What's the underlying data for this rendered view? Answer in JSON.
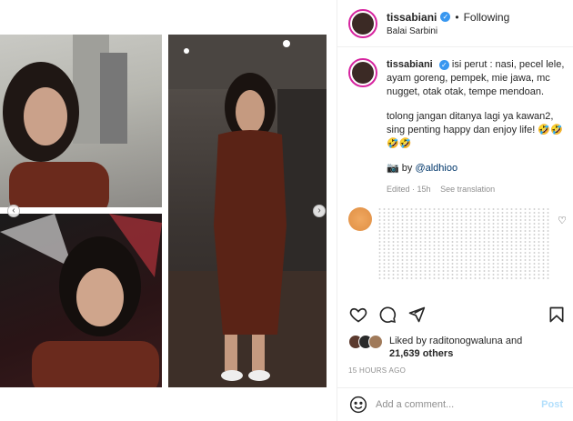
{
  "post": {
    "username": "tissabiani",
    "follow_label": "Following",
    "location": "Balai Sarbini",
    "caption_lines": [
      "isi perut : nasi, pecel lele, ayam goreng, pempek, mie jawa, mc nugget, otak otak, tempe mendoan.",
      "tolong jangan ditanya lagi ya kawan2, sing penting happy dan enjoy life! 🤣🤣🤣🤣"
    ],
    "credit_prefix": "📷 by",
    "credit_handle": "@aldhioo",
    "edited_time": "Edited · 15h",
    "see_translation": "See translation",
    "likes_prefix": "Liked by",
    "liked_by": "raditonogwaluna and",
    "likes_count": "21,639 others",
    "timestamp": "15 HOURS AGO",
    "comment_placeholder": "Add a comment...",
    "post_label": "Post"
  },
  "colors": {
    "verified": "#3897f0",
    "link": "#00376b",
    "muted": "#8e8e8e",
    "post_disabled": "#b2dffc"
  },
  "icons": [
    "verified-badge-icon",
    "heart-icon",
    "comment-icon",
    "share-icon",
    "bookmark-icon",
    "smiley-icon",
    "chevron-left-icon",
    "chevron-right-icon"
  ]
}
